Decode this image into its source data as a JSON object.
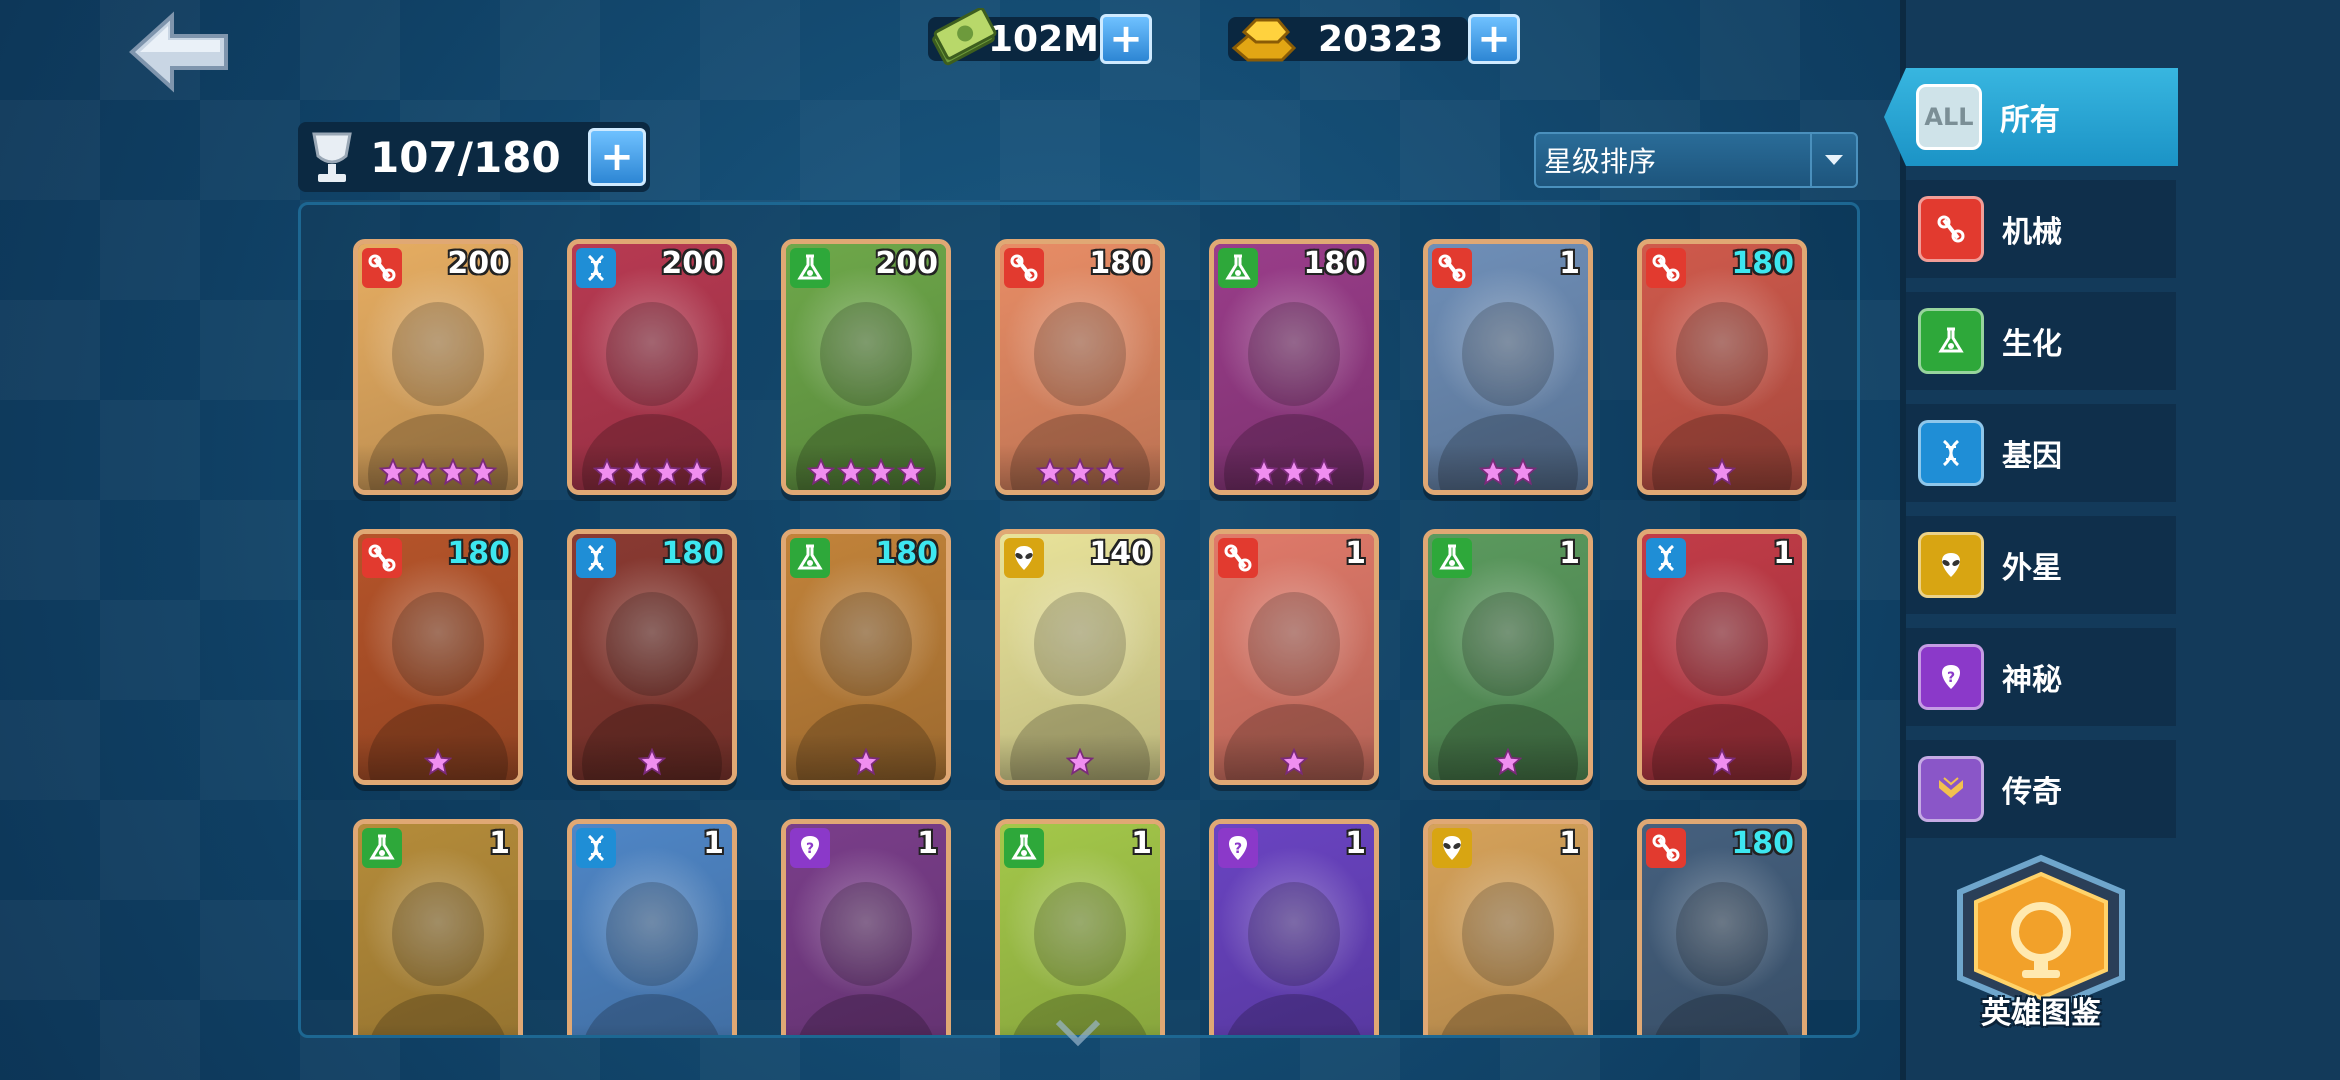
{
  "currency": {
    "cash_value": "102M",
    "gold_value": "20323"
  },
  "capacity": {
    "value": "107/180"
  },
  "sort": {
    "label": "星级排序"
  },
  "colors": {
    "mech": "#e23a2f",
    "bio": "#2ea83a",
    "gene": "#1f8ed6",
    "alien": "#d8a512",
    "mystery": "#8b39c9",
    "legend": "#8a56c8",
    "card_border": "#e0a874",
    "level_cyan": "#3de7f0"
  },
  "cards": [
    {
      "type": "mech",
      "level": "200",
      "stars": 4,
      "bg": "#e6ad62",
      "cyan": false
    },
    {
      "type": "gene",
      "level": "200",
      "stars": 4,
      "bg": "#b83a52",
      "cyan": false
    },
    {
      "type": "bio",
      "level": "200",
      "stars": 4,
      "bg": "#6ea84a",
      "cyan": false
    },
    {
      "type": "mech",
      "level": "180",
      "stars": 3,
      "bg": "#e88d66",
      "cyan": false
    },
    {
      "type": "bio",
      "level": "180",
      "stars": 3,
      "bg": "#9a3d8a",
      "cyan": false
    },
    {
      "type": "mech",
      "level": "1",
      "stars": 2,
      "bg": "#6f8fb8",
      "cyan": false
    },
    {
      "type": "mech",
      "level": "180",
      "stars": 1,
      "bg": "#cf5a4c",
      "cyan": true
    },
    {
      "type": "mech",
      "level": "180",
      "stars": 1,
      "bg": "#b5542a",
      "cyan": true
    },
    {
      "type": "gene",
      "level": "180",
      "stars": 1,
      "bg": "#8a3a32",
      "cyan": true
    },
    {
      "type": "bio",
      "level": "180",
      "stars": 1,
      "bg": "#c2833a",
      "cyan": true
    },
    {
      "type": "alien",
      "level": "140",
      "stars": 1,
      "bg": "#e9e39a",
      "cyan": false
    },
    {
      "type": "mech",
      "level": "1",
      "stars": 1,
      "bg": "#e07a6a",
      "cyan": false
    },
    {
      "type": "bio",
      "level": "1",
      "stars": 1,
      "bg": "#5b9a5e",
      "cyan": false
    },
    {
      "type": "gene",
      "level": "1",
      "stars": 1,
      "bg": "#c23c48",
      "cyan": false
    },
    {
      "type": "bio",
      "level": "1",
      "stars": 0,
      "bg": "#b58c3a",
      "cyan": false
    },
    {
      "type": "gene",
      "level": "1",
      "stars": 0,
      "bg": "#4f86c6",
      "cyan": false
    },
    {
      "type": "mystery",
      "level": "1",
      "stars": 0,
      "bg": "#7a3e8a",
      "cyan": false
    },
    {
      "type": "bio",
      "level": "1",
      "stars": 0,
      "bg": "#a4c84a",
      "cyan": false
    },
    {
      "type": "mystery",
      "level": "1",
      "stars": 0,
      "bg": "#6a44c2",
      "cyan": false
    },
    {
      "type": "alien",
      "level": "1",
      "stars": 0,
      "bg": "#d6a25a",
      "cyan": false
    },
    {
      "type": "mech",
      "level": "180",
      "stars": 0,
      "bg": "#45607e",
      "cyan": true
    }
  ],
  "sidebar": {
    "all_icon_text": "ALL",
    "items": [
      {
        "label": "所有",
        "icon": "all-icon",
        "color": "#cfe3e9"
      },
      {
        "label": "机械",
        "icon": "mech-icon",
        "color": "#e23a2f"
      },
      {
        "label": "生化",
        "icon": "bio-flask-icon",
        "color": "#2ea83a"
      },
      {
        "label": "基因",
        "icon": "dna-icon",
        "color": "#1f8ed6"
      },
      {
        "label": "外星",
        "icon": "alien-icon",
        "color": "#d8a512"
      },
      {
        "label": "神秘",
        "icon": "mystery-icon",
        "color": "#8b39c9"
      },
      {
        "label": "传奇",
        "icon": "legend-icon",
        "color": "#8a56c8"
      }
    ],
    "codex_label": "英雄图鉴"
  }
}
